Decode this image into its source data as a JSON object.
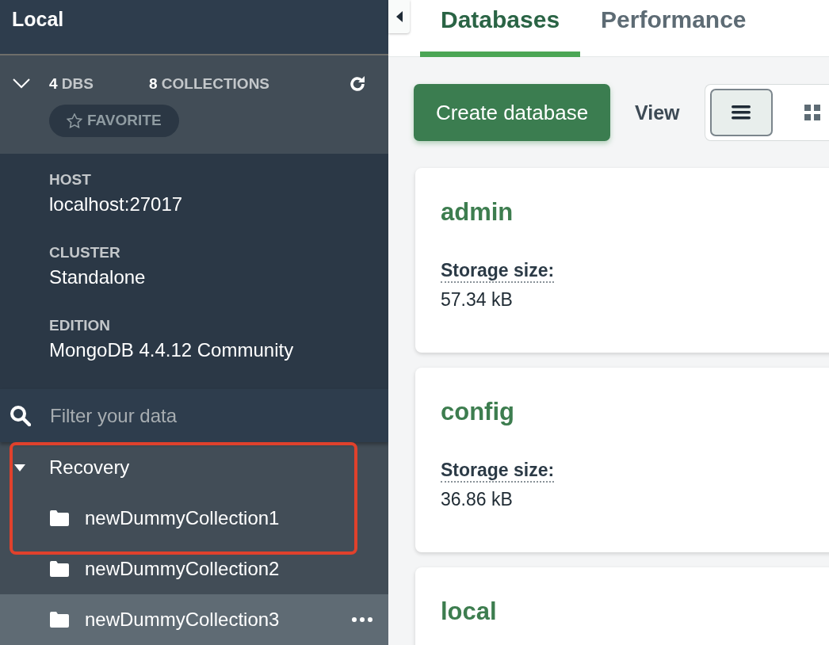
{
  "sidebar": {
    "title": "Local",
    "stats": [
      {
        "count": "4",
        "label": "DBS"
      },
      {
        "count": "8",
        "label": "COLLECTIONS"
      }
    ],
    "favorite": {
      "label": "FAVORITE",
      "selected": false
    },
    "info": [
      {
        "label": "HOST",
        "value": "localhost:27017"
      },
      {
        "label": "CLUSTER",
        "value": "Standalone"
      },
      {
        "label": "EDITION",
        "value": "MongoDB 4.4.12 Community"
      }
    ],
    "filter": {
      "placeholder": "Filter your data"
    },
    "tree": {
      "annotation_frame": true,
      "items": [
        {
          "name": "Recovery",
          "expanded": true,
          "children": [
            {
              "name": "newDummyCollection1",
              "hovered": false
            },
            {
              "name": "newDummyCollection2",
              "hovered": false
            },
            {
              "name": "newDummyCollection3",
              "hovered": true
            }
          ]
        }
      ]
    }
  },
  "tabs": [
    {
      "label": "Databases",
      "selected": true
    },
    {
      "label": "Performance",
      "selected": false
    }
  ],
  "toolbar": {
    "create_button": "Create database",
    "view_label": "View",
    "views": [
      {
        "kind": "list",
        "selected": true
      },
      {
        "kind": "grid",
        "selected": false
      }
    ]
  },
  "databases": [
    {
      "name": "admin",
      "storage_label": "Storage size:",
      "storage_value": "57.34 kB"
    },
    {
      "name": "config",
      "storage_label": "Storage size:",
      "storage_value": "36.86 kB"
    },
    {
      "name": "local"
    }
  ]
}
